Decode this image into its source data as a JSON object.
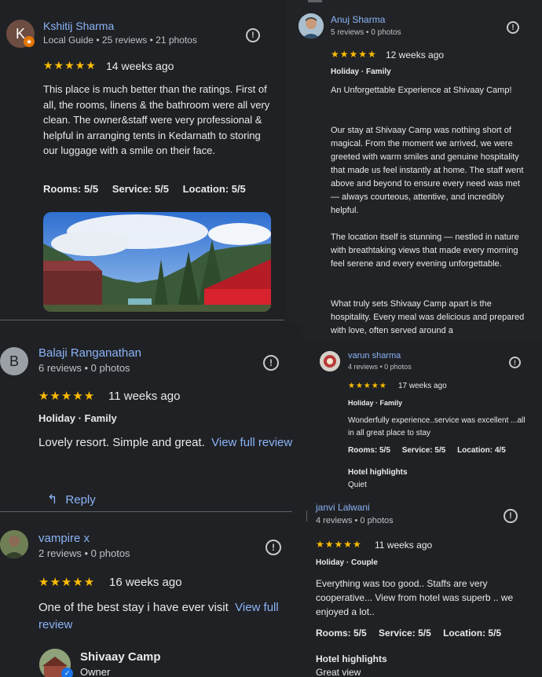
{
  "reviews": {
    "kshitij": {
      "name": "Kshitij Sharma",
      "avatar_letter": "K",
      "meta": "Local Guide • 25 reviews • 21 photos",
      "stars": "★★★★★",
      "time": "14 weeks ago",
      "text": "This place is much better than the ratings. First of all, the rooms, linens & the bathroom were all very clean. The owner&staff were very professional & helpful in arranging tents in Kedarnath to storing our luggage with a smile on their face.",
      "ratings": [
        "Rooms: 5/5",
        "Service: 5/5",
        "Location: 5/5"
      ]
    },
    "anuj": {
      "name": "Anuj Sharma",
      "meta": "5 reviews • 0 photos",
      "stars": "★★★★★",
      "time": "12 weeks ago",
      "tags": "Holiday · Family",
      "para1": "An Unforgettable Experience at Shivaay Camp!",
      "para2": "Our stay at Shivaay Camp was nothing short of magical. From the moment we arrived, we were greeted with warm smiles and genuine hospitality that made us feel instantly at home. The staff went above and beyond to ensure every need was met — always courteous, attentive, and incredibly helpful.",
      "para3": "The location itself is stunning — nestled in nature with breathtaking views that made every morning feel serene and every evening unforgettable.",
      "para4": "What truly sets Shivaay Camp apart is the hospitality. Every meal was delicious and prepared with love, often served around a"
    },
    "balaji": {
      "name": "Balaji Ranganathan",
      "avatar_letter": "B",
      "meta": "6 reviews • 0 photos",
      "stars": "★★★★★",
      "time": "11 weeks ago",
      "tags": "Holiday · Family",
      "text": "Lovely resort. Simple and great.",
      "view_full": "View full review",
      "reply": "Reply"
    },
    "varun": {
      "name": "varun sharma",
      "meta": "4 reviews • 0 photos",
      "stars": "★★★★★",
      "time": "17 weeks ago",
      "tags": "Holiday · Family",
      "text": "Wonderfully experience..service was excellent ...all in all great place to stay",
      "ratings": [
        "Rooms: 5/5",
        "Service: 5/5",
        "Location: 4/5"
      ],
      "highlights_title": "Hotel highlights",
      "highlight": "Quiet"
    },
    "vampire": {
      "name": "vampire x",
      "meta": "2 reviews • 0 photos",
      "stars": "★★★★★",
      "time": "16 weeks ago",
      "text": "One of the best stay i have ever visit",
      "view_full": "View full review",
      "owner_name": "Shivaay Camp",
      "owner_role": "Owner"
    },
    "janvi": {
      "name": "janvi Lalwani",
      "meta": "4 reviews • 0 photos",
      "stars": "★★★★★",
      "time": "11 weeks ago",
      "tags": "Holiday · Couple",
      "text": "Everything was too good.. Staffs are very cooperative... View from hotel was superb .. we enjoyed a lot..",
      "ratings": [
        "Rooms: 5/5",
        "Service: 5/5",
        "Location: 5/5"
      ],
      "highlights_title": "Hotel highlights",
      "highlight": "Great view"
    }
  },
  "colors": {
    "background": "#202124",
    "link": "#8ab4f8",
    "star": "#fbbc04"
  },
  "icons": {
    "report": "report-flag-icon",
    "reply": "reply-arrow-icon",
    "verified": "verified-check-icon",
    "local_guide": "local-guide-star-icon"
  }
}
